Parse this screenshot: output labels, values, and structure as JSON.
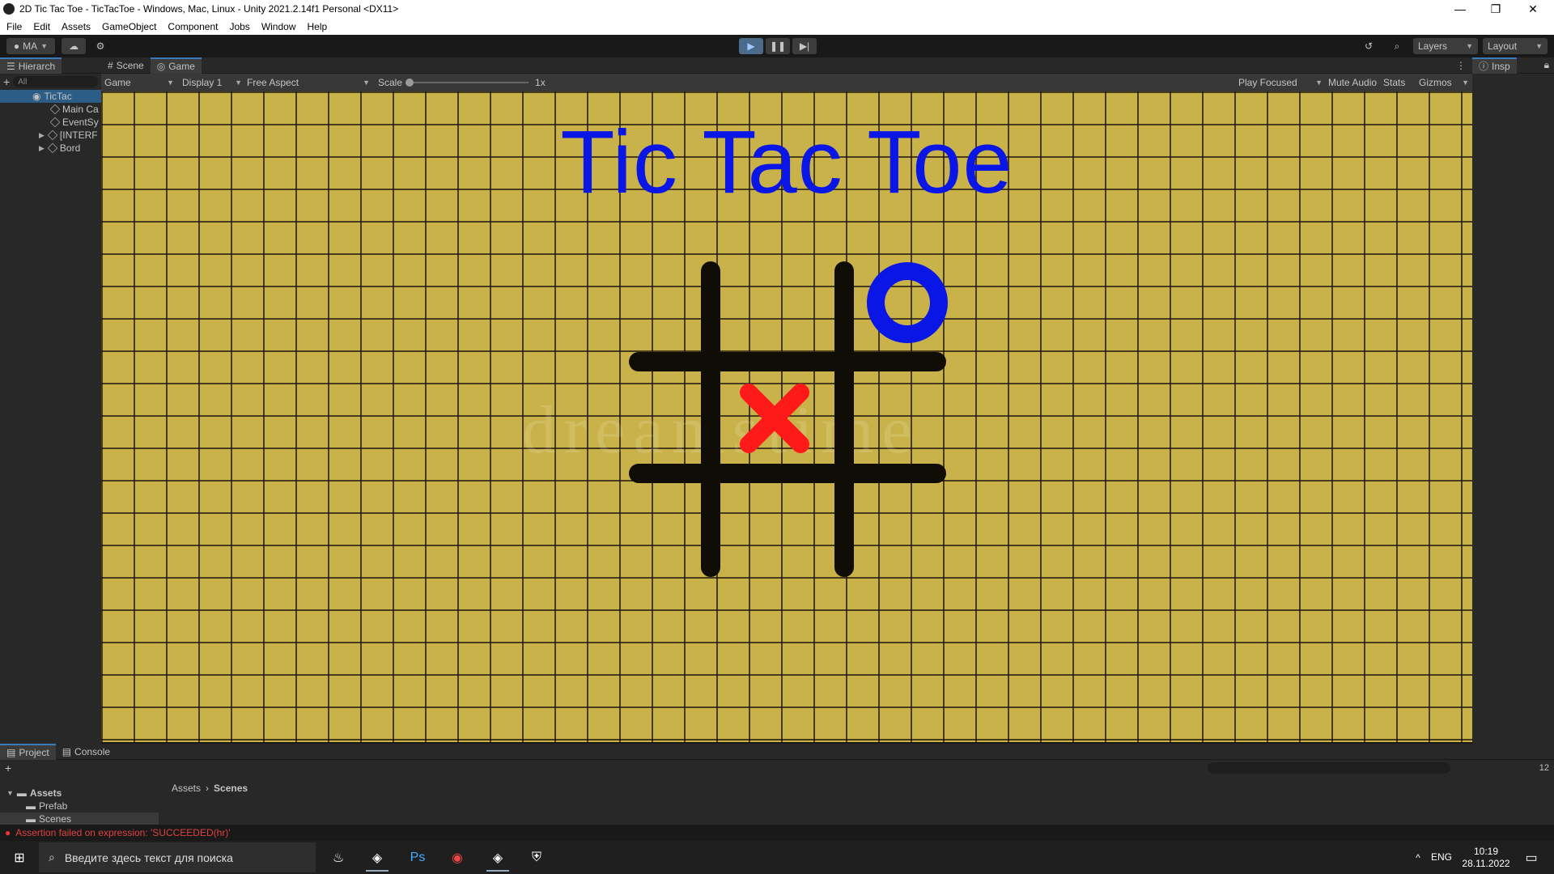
{
  "window": {
    "title": "2D Tic Tac Toe - TicTacToe - Windows, Mac, Linux - Unity 2021.2.14f1 Personal <DX11>",
    "minimize": "—",
    "maximize": "❐",
    "close": "✕"
  },
  "menu": [
    "File",
    "Edit",
    "Assets",
    "GameObject",
    "Component",
    "Jobs",
    "Window",
    "Help"
  ],
  "toolbar": {
    "account": "MA",
    "layers": "Layers",
    "layout": "Layout"
  },
  "hierarchy": {
    "tab": "Hierarch",
    "search_placeholder": "All",
    "root": "TicTac",
    "items": [
      "Main Ca",
      "EventSy",
      "[INTERF",
      "Bord"
    ]
  },
  "tabs": {
    "scene": "Scene",
    "game": "Game",
    "inspector": "Insp"
  },
  "gamebar": {
    "mode": "Game",
    "display": "Display 1",
    "aspect": "Free Aspect",
    "scale_label": "Scale",
    "scale_value": "1x",
    "play_focused": "Play Focused",
    "mute": "Mute Audio",
    "stats": "Stats",
    "gizmos": "Gizmos"
  },
  "game": {
    "title": "Tic Tac Toe",
    "watermark": "dreamstime",
    "board": {
      "cells": [
        "",
        "",
        "O",
        "",
        "X",
        "",
        "",
        "",
        ""
      ]
    },
    "colors": {
      "background": "#c9b24a",
      "title": "#0a16e6",
      "x_mark": "#ff1a1a",
      "o_mark": "#0a16e6",
      "grid": "#100c06"
    }
  },
  "bottom": {
    "project_tab": "Project",
    "console_tab": "Console",
    "assets_root": "Assets",
    "folders": [
      "Prefab",
      "Scenes"
    ],
    "breadcrumb": [
      "Assets",
      "Scenes"
    ],
    "hidden_count": "12"
  },
  "status": {
    "message": "Assertion failed on expression: 'SUCCEEDED(hr)'"
  },
  "taskbar": {
    "search_placeholder": "Введите здесь текст для поиска",
    "lang": "ENG",
    "time": "10:19",
    "date": "28.11.2022"
  }
}
